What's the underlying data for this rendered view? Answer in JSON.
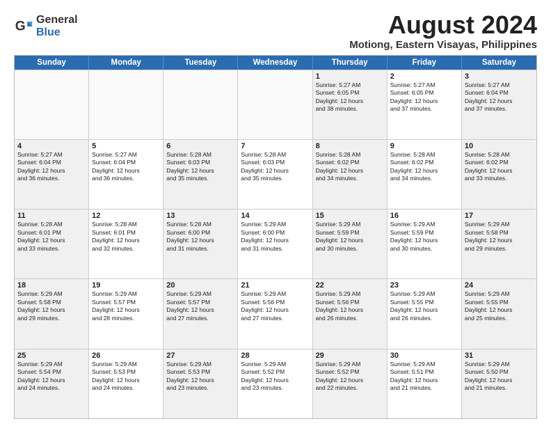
{
  "logo": {
    "general": "General",
    "blue": "Blue"
  },
  "title": "August 2024",
  "subtitle": "Motiong, Eastern Visayas, Philippines",
  "days": [
    "Sunday",
    "Monday",
    "Tuesday",
    "Wednesday",
    "Thursday",
    "Friday",
    "Saturday"
  ],
  "rows": [
    [
      {
        "num": "",
        "info": "",
        "empty": true
      },
      {
        "num": "",
        "info": "",
        "empty": true
      },
      {
        "num": "",
        "info": "",
        "empty": true
      },
      {
        "num": "",
        "info": "",
        "empty": true
      },
      {
        "num": "1",
        "info": "Sunrise: 5:27 AM\nSunset: 6:05 PM\nDaylight: 12 hours\nand 38 minutes.",
        "empty": false
      },
      {
        "num": "2",
        "info": "Sunrise: 5:27 AM\nSunset: 6:05 PM\nDaylight: 12 hours\nand 37 minutes.",
        "empty": false
      },
      {
        "num": "3",
        "info": "Sunrise: 5:27 AM\nSunset: 6:04 PM\nDaylight: 12 hours\nand 37 minutes.",
        "empty": false
      }
    ],
    [
      {
        "num": "4",
        "info": "Sunrise: 5:27 AM\nSunset: 6:04 PM\nDaylight: 12 hours\nand 36 minutes.",
        "empty": false
      },
      {
        "num": "5",
        "info": "Sunrise: 5:27 AM\nSunset: 6:04 PM\nDaylight: 12 hours\nand 36 minutes.",
        "empty": false
      },
      {
        "num": "6",
        "info": "Sunrise: 5:28 AM\nSunset: 6:03 PM\nDaylight: 12 hours\nand 35 minutes.",
        "empty": false
      },
      {
        "num": "7",
        "info": "Sunrise: 5:28 AM\nSunset: 6:03 PM\nDaylight: 12 hours\nand 35 minutes.",
        "empty": false
      },
      {
        "num": "8",
        "info": "Sunrise: 5:28 AM\nSunset: 6:02 PM\nDaylight: 12 hours\nand 34 minutes.",
        "empty": false
      },
      {
        "num": "9",
        "info": "Sunrise: 5:28 AM\nSunset: 6:02 PM\nDaylight: 12 hours\nand 34 minutes.",
        "empty": false
      },
      {
        "num": "10",
        "info": "Sunrise: 5:28 AM\nSunset: 6:02 PM\nDaylight: 12 hours\nand 33 minutes.",
        "empty": false
      }
    ],
    [
      {
        "num": "11",
        "info": "Sunrise: 5:28 AM\nSunset: 6:01 PM\nDaylight: 12 hours\nand 33 minutes.",
        "empty": false
      },
      {
        "num": "12",
        "info": "Sunrise: 5:28 AM\nSunset: 6:01 PM\nDaylight: 12 hours\nand 32 minutes.",
        "empty": false
      },
      {
        "num": "13",
        "info": "Sunrise: 5:28 AM\nSunset: 6:00 PM\nDaylight: 12 hours\nand 31 minutes.",
        "empty": false
      },
      {
        "num": "14",
        "info": "Sunrise: 5:29 AM\nSunset: 6:00 PM\nDaylight: 12 hours\nand 31 minutes.",
        "empty": false
      },
      {
        "num": "15",
        "info": "Sunrise: 5:29 AM\nSunset: 5:59 PM\nDaylight: 12 hours\nand 30 minutes.",
        "empty": false
      },
      {
        "num": "16",
        "info": "Sunrise: 5:29 AM\nSunset: 5:59 PM\nDaylight: 12 hours\nand 30 minutes.",
        "empty": false
      },
      {
        "num": "17",
        "info": "Sunrise: 5:29 AM\nSunset: 5:58 PM\nDaylight: 12 hours\nand 29 minutes.",
        "empty": false
      }
    ],
    [
      {
        "num": "18",
        "info": "Sunrise: 5:29 AM\nSunset: 5:58 PM\nDaylight: 12 hours\nand 29 minutes.",
        "empty": false
      },
      {
        "num": "19",
        "info": "Sunrise: 5:29 AM\nSunset: 5:57 PM\nDaylight: 12 hours\nand 28 minutes.",
        "empty": false
      },
      {
        "num": "20",
        "info": "Sunrise: 5:29 AM\nSunset: 5:57 PM\nDaylight: 12 hours\nand 27 minutes.",
        "empty": false
      },
      {
        "num": "21",
        "info": "Sunrise: 5:29 AM\nSunset: 5:56 PM\nDaylight: 12 hours\nand 27 minutes.",
        "empty": false
      },
      {
        "num": "22",
        "info": "Sunrise: 5:29 AM\nSunset: 5:56 PM\nDaylight: 12 hours\nand 26 minutes.",
        "empty": false
      },
      {
        "num": "23",
        "info": "Sunrise: 5:29 AM\nSunset: 5:55 PM\nDaylight: 12 hours\nand 26 minutes.",
        "empty": false
      },
      {
        "num": "24",
        "info": "Sunrise: 5:29 AM\nSunset: 5:55 PM\nDaylight: 12 hours\nand 25 minutes.",
        "empty": false
      }
    ],
    [
      {
        "num": "25",
        "info": "Sunrise: 5:29 AM\nSunset: 5:54 PM\nDaylight: 12 hours\nand 24 minutes.",
        "empty": false
      },
      {
        "num": "26",
        "info": "Sunrise: 5:29 AM\nSunset: 5:53 PM\nDaylight: 12 hours\nand 24 minutes.",
        "empty": false
      },
      {
        "num": "27",
        "info": "Sunrise: 5:29 AM\nSunset: 5:53 PM\nDaylight: 12 hours\nand 23 minutes.",
        "empty": false
      },
      {
        "num": "28",
        "info": "Sunrise: 5:29 AM\nSunset: 5:52 PM\nDaylight: 12 hours\nand 23 minutes.",
        "empty": false
      },
      {
        "num": "29",
        "info": "Sunrise: 5:29 AM\nSunset: 5:52 PM\nDaylight: 12 hours\nand 22 minutes.",
        "empty": false
      },
      {
        "num": "30",
        "info": "Sunrise: 5:29 AM\nSunset: 5:51 PM\nDaylight: 12 hours\nand 21 minutes.",
        "empty": false
      },
      {
        "num": "31",
        "info": "Sunrise: 5:29 AM\nSunset: 5:50 PM\nDaylight: 12 hours\nand 21 minutes.",
        "empty": false
      }
    ]
  ]
}
